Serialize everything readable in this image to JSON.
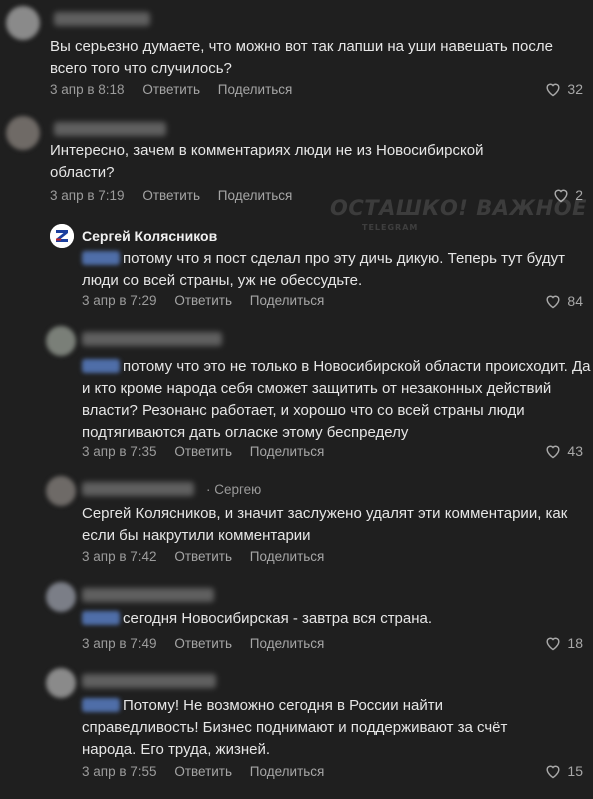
{
  "actions": {
    "reply": "Ответить",
    "share": "Поделиться"
  },
  "watermark": {
    "title": "ОСТАШКО! ВАЖНОЕ",
    "subtitle": "TELEGRAM"
  },
  "comments": [
    {
      "author": "",
      "text": "Вы серьезно думаете, что можно вот так лапши на уши навешать после всего того что случилось?",
      "time": "3 апр в 8:18",
      "likes": "32"
    },
    {
      "author": "",
      "text": "Интересно, зачем в комментариях люди не из Новосибирской области?",
      "time": "3 апр в 7:19",
      "likes": "2"
    },
    {
      "author": "Сергей Колясников",
      "text": "потому что я пост сделал про эту дичь дикую. Теперь тут будут люди со всей страны, уж не обессудьте.",
      "time": "3 апр в 7:29",
      "likes": "84"
    },
    {
      "author": "",
      "text": "потому что это не только в Новосибирской области происходит. Да и кто кроме народа себя сможет защитить от незаконных действий власти? Резонанс работает, и хорошо что со всей страны люди подтягиваются дать огласке этому беспределу",
      "time": "3 апр в 7:35",
      "likes": "43"
    },
    {
      "author": "",
      "reply_to": "· Сергею",
      "text": "Сергей Колясников, и значит заслужено удалят эти комментарии, как если бы накрутили комментарии",
      "time": "3 апр в 7:42",
      "likes": ""
    },
    {
      "author": "",
      "text": "сегодня Новосибирская - завтра вся страна.",
      "time": "3 апр в 7:49",
      "likes": "18"
    },
    {
      "author": "",
      "text": "Потому! Не возможно сегодня в России найти справедливость! Бизнес поднимают и поддерживают за счёт народа. Его труда, жизней.",
      "time": "3 апр в 7:55",
      "likes": "15"
    }
  ]
}
